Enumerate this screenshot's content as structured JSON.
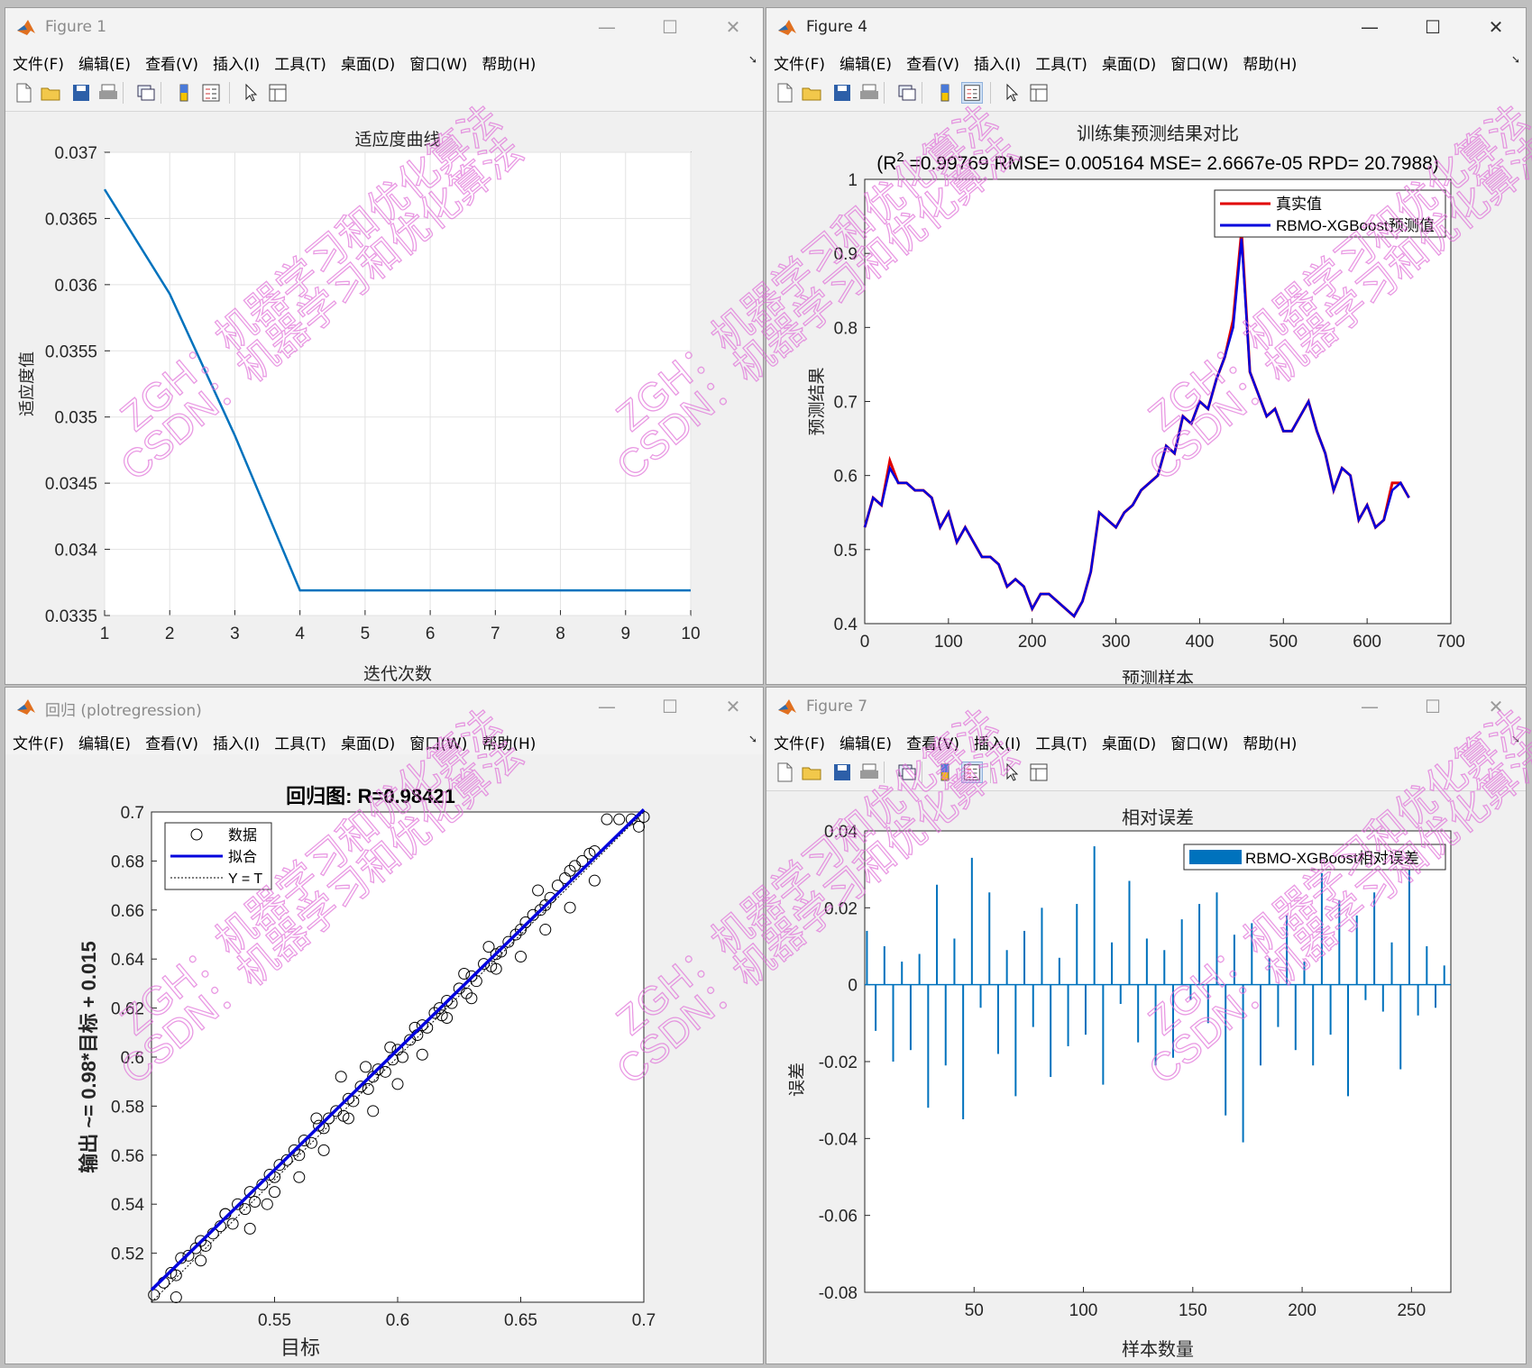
{
  "windows": {
    "fig1": {
      "title": "Figure 1",
      "minimize": "—",
      "maximize": "☐",
      "close": "✕",
      "menus": [
        "文件(F)",
        "编辑(E)",
        "查看(V)",
        "插入(I)",
        "工具(T)",
        "桌面(D)",
        "窗口(W)",
        "帮助(H)"
      ]
    },
    "fig4": {
      "title": "Figure 4",
      "minimize": "—",
      "maximize": "☐",
      "close": "✕",
      "menus": [
        "文件(F)",
        "编辑(E)",
        "查看(V)",
        "插入(I)",
        "工具(T)",
        "桌面(D)",
        "窗口(W)",
        "帮助(H)"
      ]
    },
    "reg": {
      "title": "回归 (plotregression)",
      "minimize": "—",
      "maximize": "☐",
      "close": "✕",
      "menus": [
        "文件(F)",
        "编辑(E)",
        "查看(V)",
        "插入(I)",
        "工具(T)",
        "桌面(D)",
        "窗口(W)",
        "帮助(H)"
      ]
    },
    "fig7": {
      "title": "Figure 7",
      "minimize": "—",
      "maximize": "☐",
      "close": "✕",
      "menus": [
        "文件(F)",
        "编辑(E)",
        "查看(V)",
        "插入(I)",
        "工具(T)",
        "桌面(D)",
        "窗口(W)",
        "帮助(H)"
      ]
    }
  },
  "icons": {
    "toolbar": [
      "new-file-icon",
      "open-folder-icon",
      "save-icon",
      "print-icon",
      "link-figure-icon",
      "colorbar-icon",
      "legend-icon",
      "pointer-icon",
      "property-inspector-icon"
    ],
    "matlab": "matlab-logo-icon"
  },
  "colors": {
    "matlab_blue": "#0072BD",
    "true_red": "#e00000",
    "pred_blue": "#0000dd",
    "watermark": "#e070d8"
  },
  "watermark": {
    "lines": [
      "ZGH：机器学习和优化算法",
      "CSDN：机器学习和优化算法"
    ]
  },
  "chart_data": [
    {
      "id": "fitness",
      "type": "line",
      "title": "适应度曲线",
      "xlabel": "迭代次数",
      "ylabel": "适应度值",
      "xlim": [
        1,
        10
      ],
      "ylim": [
        0.0335,
        0.037
      ],
      "xticks": [
        "1",
        "2",
        "3",
        "4",
        "5",
        "6",
        "7",
        "8",
        "9",
        "10"
      ],
      "yticks": [
        "0.037",
        "0.0365",
        "0.036",
        "0.0355",
        "0.035",
        "0.0345",
        "0.034",
        "0.0335"
      ],
      "grid": true,
      "x": [
        1,
        2,
        3,
        4,
        5,
        6,
        7,
        8,
        9,
        10
      ],
      "y": [
        0.03672,
        0.03593,
        0.03486,
        0.03369,
        0.03369,
        0.03369,
        0.03369,
        0.03369,
        0.03369,
        0.03369
      ]
    },
    {
      "id": "train_compare",
      "type": "line",
      "title": "训练集预测结果对比",
      "subtitle_prefix": "(R",
      "subtitle_sup": "2",
      "subtitle_rest": " =0.99769 RMSE= 0.005164 MSE= 2.6667e-05 RPD= 20.7988)",
      "xlabel": "预测样本",
      "ylabel": "预测结果",
      "xlim": [
        0,
        700
      ],
      "ylim": [
        0.4,
        1
      ],
      "xticks": [
        "0",
        "100",
        "200",
        "300",
        "400",
        "500",
        "600",
        "700"
      ],
      "yticks": [
        "1",
        "0.9",
        "0.8",
        "0.7",
        "0.6",
        "0.5",
        "0.4"
      ],
      "legend": [
        "真实值",
        "RBMO-XGBoost预测值"
      ],
      "legend_position": "top-right",
      "series": [
        {
          "name": "真实值",
          "x": [
            0,
            10,
            20,
            30,
            40,
            50,
            60,
            70,
            80,
            90,
            100,
            110,
            120,
            130,
            140,
            150,
            160,
            170,
            180,
            190,
            200,
            210,
            220,
            230,
            240,
            250,
            260,
            270,
            280,
            290,
            300,
            310,
            320,
            330,
            340,
            350,
            360,
            370,
            380,
            390,
            400,
            410,
            420,
            430,
            440,
            450,
            460,
            470,
            480,
            490,
            500,
            510,
            520,
            530,
            540,
            550,
            560,
            570,
            580,
            590,
            600,
            610,
            620,
            630,
            640,
            650
          ],
          "values": [
            0.53,
            0.57,
            0.56,
            0.62,
            0.59,
            0.59,
            0.58,
            0.58,
            0.57,
            0.53,
            0.55,
            0.51,
            0.53,
            0.51,
            0.49,
            0.49,
            0.48,
            0.45,
            0.46,
            0.45,
            0.42,
            0.44,
            0.44,
            0.43,
            0.42,
            0.41,
            0.43,
            0.47,
            0.55,
            0.54,
            0.53,
            0.55,
            0.56,
            0.58,
            0.59,
            0.6,
            0.64,
            0.63,
            0.68,
            0.67,
            0.7,
            0.69,
            0.73,
            0.76,
            0.81,
            0.93,
            0.74,
            0.71,
            0.68,
            0.69,
            0.66,
            0.66,
            0.68,
            0.7,
            0.66,
            0.63,
            0.58,
            0.61,
            0.6,
            0.54,
            0.56,
            0.53,
            0.54,
            0.59,
            0.59,
            0.57
          ]
        },
        {
          "name": "RBMO-XGBoost预测值",
          "x": [
            0,
            10,
            20,
            30,
            40,
            50,
            60,
            70,
            80,
            90,
            100,
            110,
            120,
            130,
            140,
            150,
            160,
            170,
            180,
            190,
            200,
            210,
            220,
            230,
            240,
            250,
            260,
            270,
            280,
            290,
            300,
            310,
            320,
            330,
            340,
            350,
            360,
            370,
            380,
            390,
            400,
            410,
            420,
            430,
            440,
            450,
            460,
            470,
            480,
            490,
            500,
            510,
            520,
            530,
            540,
            550,
            560,
            570,
            580,
            590,
            600,
            610,
            620,
            630,
            640,
            650
          ],
          "values": [
            0.53,
            0.57,
            0.56,
            0.61,
            0.59,
            0.59,
            0.58,
            0.58,
            0.57,
            0.53,
            0.55,
            0.51,
            0.53,
            0.51,
            0.49,
            0.49,
            0.48,
            0.45,
            0.46,
            0.45,
            0.42,
            0.44,
            0.44,
            0.43,
            0.42,
            0.41,
            0.43,
            0.47,
            0.55,
            0.54,
            0.53,
            0.55,
            0.56,
            0.58,
            0.59,
            0.6,
            0.64,
            0.63,
            0.68,
            0.67,
            0.7,
            0.69,
            0.73,
            0.76,
            0.8,
            0.92,
            0.74,
            0.71,
            0.68,
            0.69,
            0.66,
            0.66,
            0.68,
            0.7,
            0.66,
            0.63,
            0.58,
            0.61,
            0.6,
            0.54,
            0.56,
            0.53,
            0.54,
            0.58,
            0.59,
            0.57
          ]
        }
      ]
    },
    {
      "id": "regression",
      "type": "scatter",
      "title": "回归图: R=0.98421",
      "xlabel": "目标",
      "ylabel": "输出 ~= 0.98*目标 + 0.015",
      "xlim": [
        0.5,
        0.7
      ],
      "ylim": [
        0.5,
        0.7
      ],
      "xticks": [
        "0.55",
        "0.6",
        "0.65",
        "0.7"
      ],
      "yticks": [
        "0.7",
        "0.68",
        "0.66",
        "0.64",
        "0.62",
        "0.6",
        "0.58",
        "0.56",
        "0.54",
        "0.52"
      ],
      "legend": [
        "数据",
        "拟合",
        "Y = T"
      ],
      "legend_position": "top-left",
      "fit": {
        "slope": 0.98,
        "intercept": 0.015
      },
      "x": [
        0.501,
        0.505,
        0.508,
        0.51,
        0.512,
        0.515,
        0.518,
        0.52,
        0.522,
        0.525,
        0.528,
        0.53,
        0.533,
        0.535,
        0.538,
        0.54,
        0.542,
        0.545,
        0.548,
        0.55,
        0.552,
        0.555,
        0.558,
        0.56,
        0.562,
        0.565,
        0.568,
        0.57,
        0.572,
        0.575,
        0.578,
        0.58,
        0.582,
        0.585,
        0.588,
        0.59,
        0.592,
        0.595,
        0.598,
        0.6,
        0.602,
        0.605,
        0.608,
        0.61,
        0.612,
        0.615,
        0.618,
        0.62,
        0.622,
        0.625,
        0.628,
        0.63,
        0.632,
        0.635,
        0.638,
        0.64,
        0.642,
        0.645,
        0.648,
        0.65,
        0.652,
        0.655,
        0.658,
        0.66,
        0.662,
        0.665,
        0.668,
        0.67,
        0.672,
        0.675,
        0.678,
        0.68,
        0.685,
        0.69,
        0.695,
        0.698,
        0.7,
        0.51,
        0.53,
        0.55,
        0.57,
        0.59,
        0.61,
        0.63,
        0.65,
        0.67,
        0.52,
        0.54,
        0.56,
        0.58,
        0.6,
        0.62,
        0.64,
        0.66,
        0.68,
        0.577,
        0.597,
        0.617,
        0.637,
        0.657,
        0.547,
        0.567,
        0.587,
        0.607,
        0.627
      ],
      "y": [
        0.503,
        0.508,
        0.512,
        0.511,
        0.518,
        0.519,
        0.522,
        0.525,
        0.523,
        0.528,
        0.531,
        0.536,
        0.532,
        0.54,
        0.538,
        0.545,
        0.541,
        0.548,
        0.552,
        0.551,
        0.556,
        0.558,
        0.562,
        0.56,
        0.566,
        0.565,
        0.572,
        0.571,
        0.575,
        0.578,
        0.576,
        0.583,
        0.582,
        0.588,
        0.587,
        0.592,
        0.595,
        0.594,
        0.599,
        0.603,
        0.6,
        0.607,
        0.609,
        0.613,
        0.612,
        0.618,
        0.617,
        0.623,
        0.622,
        0.628,
        0.626,
        0.633,
        0.631,
        0.638,
        0.637,
        0.642,
        0.643,
        0.647,
        0.65,
        0.652,
        0.655,
        0.658,
        0.66,
        0.662,
        0.665,
        0.67,
        0.673,
        0.676,
        0.678,
        0.68,
        0.683,
        0.684,
        0.697,
        0.697,
        0.697,
        0.694,
        0.698,
        0.502,
        0.536,
        0.545,
        0.562,
        0.578,
        0.601,
        0.624,
        0.641,
        0.661,
        0.517,
        0.53,
        0.551,
        0.575,
        0.589,
        0.616,
        0.636,
        0.652,
        0.672,
        0.592,
        0.604,
        0.62,
        0.645,
        0.668,
        0.54,
        0.575,
        0.596,
        0.612,
        0.634
      ]
    },
    {
      "id": "relative_error",
      "type": "bar",
      "title": "相对误差",
      "xlabel": "样本数量",
      "ylabel": "误差",
      "xlim": [
        0,
        268
      ],
      "ylim": [
        -0.08,
        0.04
      ],
      "xticks": [
        "50",
        "100",
        "150",
        "200",
        "250"
      ],
      "yticks": [
        "0.04",
        "0.02",
        "0",
        "-0.02",
        "-0.04",
        "-0.06",
        "-0.08"
      ],
      "legend": [
        "RBMO-XGBoost相对误差"
      ],
      "legend_position": "top-right",
      "x": [
        1,
        5,
        9,
        13,
        17,
        21,
        25,
        29,
        33,
        37,
        41,
        45,
        49,
        53,
        57,
        61,
        65,
        69,
        73,
        77,
        81,
        85,
        89,
        93,
        97,
        101,
        105,
        109,
        113,
        117,
        121,
        125,
        129,
        133,
        137,
        141,
        145,
        149,
        153,
        157,
        161,
        165,
        169,
        173,
        177,
        181,
        185,
        189,
        193,
        197,
        201,
        205,
        209,
        213,
        217,
        221,
        225,
        229,
        233,
        237,
        241,
        245,
        249,
        253,
        257,
        261,
        265
      ],
      "values": [
        0.014,
        -0.012,
        0.01,
        -0.02,
        0.006,
        -0.017,
        0.008,
        -0.032,
        0.026,
        -0.021,
        0.012,
        -0.035,
        0.033,
        -0.006,
        0.024,
        -0.018,
        0.009,
        -0.029,
        0.014,
        -0.011,
        0.02,
        -0.024,
        0.007,
        -0.016,
        0.021,
        -0.013,
        0.036,
        -0.026,
        0.011,
        -0.005,
        0.027,
        -0.015,
        0.012,
        -0.021,
        0.009,
        -0.019,
        0.017,
        -0.004,
        0.021,
        -0.01,
        0.024,
        -0.034,
        0.013,
        -0.041,
        0.016,
        -0.021,
        0.007,
        -0.011,
        0.018,
        -0.017,
        0.006,
        -0.021,
        0.029,
        -0.013,
        0.022,
        -0.029,
        0.018,
        -0.004,
        0.024,
        -0.007,
        0.011,
        -0.022,
        0.033,
        -0.008,
        0.01,
        -0.006,
        0.005
      ]
    }
  ]
}
